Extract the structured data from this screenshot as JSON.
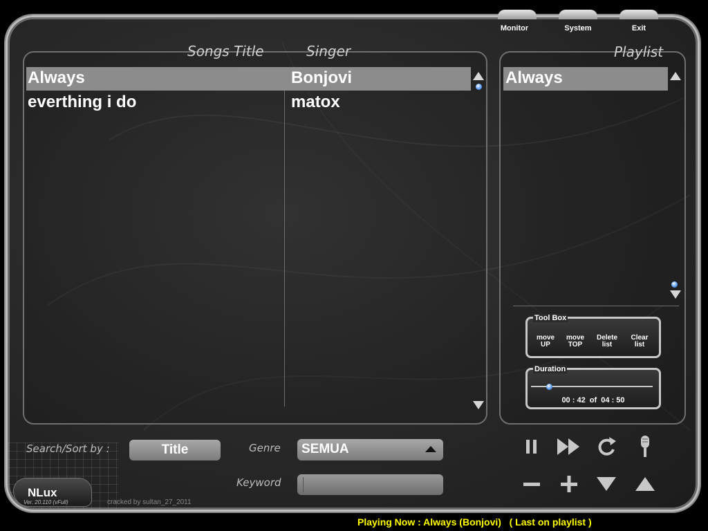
{
  "top_menu": {
    "monitor": "Monitor",
    "system": "System",
    "exit": "Exit"
  },
  "songs": {
    "title_header": "Songs Title",
    "singer_header": "Singer",
    "rows": [
      {
        "title": "Always",
        "singer": "Bonjovi",
        "selected": true
      },
      {
        "title": "everthing i do",
        "singer": "matox",
        "selected": false
      }
    ]
  },
  "playlist": {
    "header": "Playlist",
    "items": [
      {
        "title": "Always",
        "selected": true
      }
    ]
  },
  "toolbox": {
    "label": "Tool Box",
    "move_up": [
      "move",
      "UP"
    ],
    "move_top": [
      "move",
      "TOP"
    ],
    "delete": [
      "Delete",
      "list"
    ],
    "clear": [
      "Clear",
      "list"
    ]
  },
  "duration": {
    "label": "Duration",
    "time": "00 : 42  of  04 : 50",
    "progress": 0.145
  },
  "search": {
    "label": "Search/Sort by :",
    "sort_value": "Title",
    "genre_label": "Genre",
    "genre_value": "SEMUA",
    "keyword_label": "Keyword",
    "keyword_value": ""
  },
  "brand": {
    "logo": "NLux",
    "version": "Ver. 20.110 (vFull)",
    "cracked": "cracked by sultan_27_2011"
  },
  "status": {
    "playing": "Playing Now : Always (Bonjovi)   ( Last on playlist )",
    "color": "#ffff00"
  },
  "icons": [
    "pause-icon",
    "fast-forward-icon",
    "repeat-icon",
    "microphone-icon",
    "minus-icon",
    "plus-icon",
    "down-arrow-icon",
    "up-arrow-icon"
  ]
}
